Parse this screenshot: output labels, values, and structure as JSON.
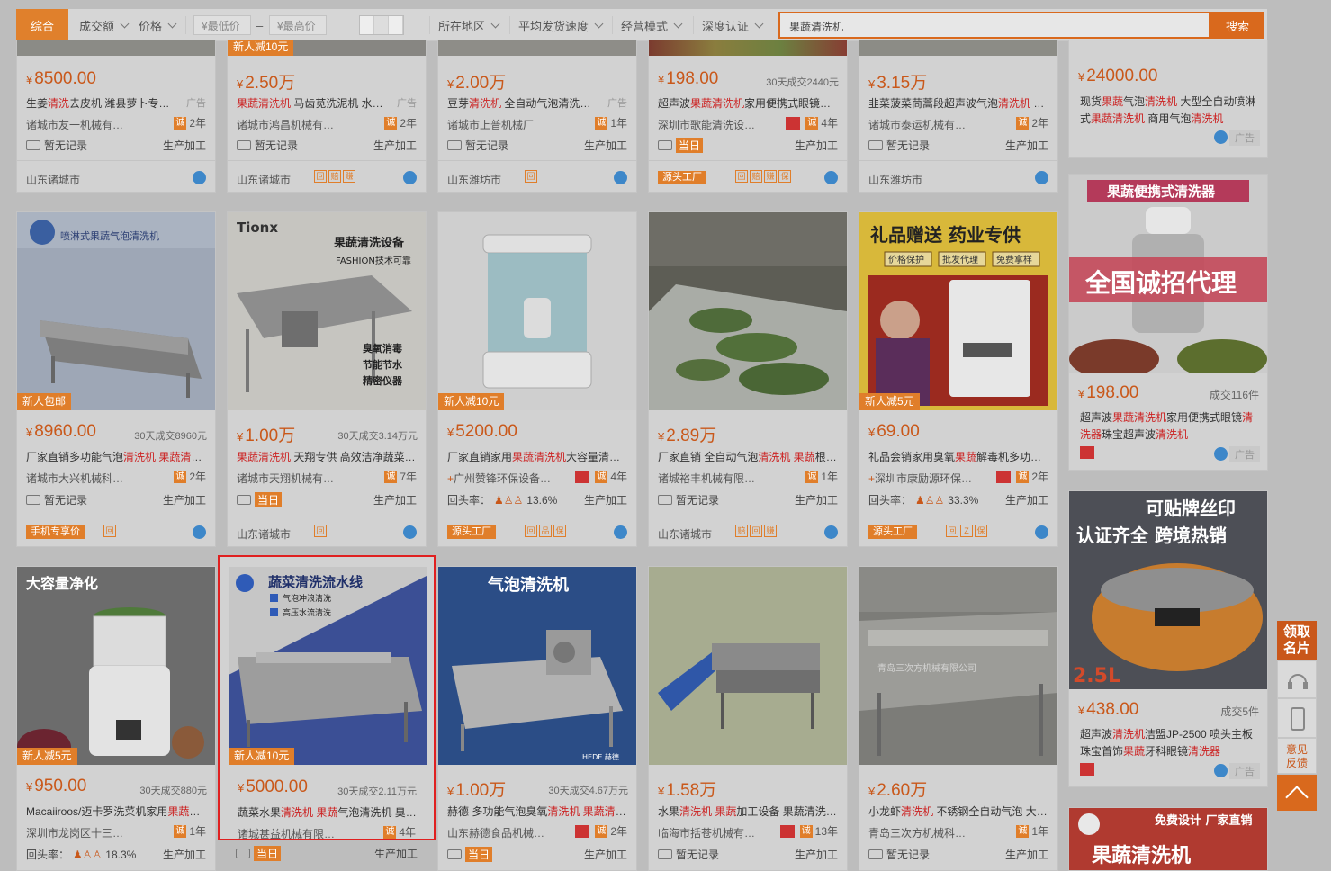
{
  "filter": {
    "tab_all": "综合",
    "sort_volume": "成交额",
    "sort_price": "价格",
    "price_min": "¥最低价",
    "price_dash": "–",
    "price_max": "¥最高价",
    "region": "所在地区",
    "delivery": "平均发货速度",
    "mode": "经营模式",
    "certify": "深度认证",
    "search_value": "果蔬清洗机",
    "search_button": "搜索"
  },
  "row0": [
    {
      "price": "8500.00",
      "sold": "",
      "ad": "广告",
      "title_pre": "生姜",
      "title_em": "清洗",
      "title_post": "去皮机 潍县萝卜专…",
      "shop": "诸城市友一机械有…",
      "years": "2年",
      "record": "暂无记录",
      "proc": "生产加工",
      "loc": "山东诸城市"
    },
    {
      "price": "2.50万",
      "sold": "",
      "ad": "广告",
      "promo": "新人减10元",
      "title_pre": "",
      "title_em": "果蔬清洗机",
      "title_post": " 马齿苋洗泥机 水…",
      "shop": "诸城市鸿昌机械有…",
      "years": "2年",
      "record": "暂无记录",
      "proc": "生产加工",
      "loc": "山东诸城市"
    },
    {
      "price": "2.00万",
      "sold": "",
      "ad": "广告",
      "title_pre": "豆芽",
      "title_em": "清洗机",
      "title_post": " 全自动气泡清洗…",
      "shop": "诸城市上普机械厂",
      "years": "1年",
      "record": "暂无记录",
      "proc": "生产加工",
      "loc": "山东潍坊市"
    },
    {
      "price": "198.00",
      "sold": "30天成交2440元",
      "ad": "",
      "title_pre": "超声波",
      "title_em": "果蔬清洗机",
      "title_post": "家用便携式眼镜…",
      "shop": "深圳市歌能清洗设…",
      "years": "4年",
      "record": "当日",
      "proc": "生产加工",
      "loc": "源头工厂"
    },
    {
      "price": "3.15万",
      "sold": "",
      "ad": "",
      "title_pre": "韭菜菠菜茼蒿段超声波气泡",
      "title_em": "清洗机",
      "title_post": " …",
      "shop": "诸城市泰运机械有…",
      "years": "2年",
      "record": "暂无记录",
      "proc": "生产加工",
      "loc": "山东潍坊市"
    }
  ],
  "row1": [
    {
      "price": "8960.00",
      "sold": "30天成交8960元",
      "promo": "新人包邮",
      "img_text": "喷淋式果蔬气泡清洗机",
      "title_pre": "厂家直销多功能气泡",
      "title_em": "清洗机 果蔬清",
      "title_post": "…",
      "shop": "诸城市大兴机械科…",
      "years": "2年",
      "record": "暂无记录",
      "proc": "生产加工",
      "loc": "手机专享价"
    },
    {
      "price": "1.00万",
      "sold": "30天成交3.14万元",
      "promo": "",
      "img_text": "果蔬清洗设备",
      "img_sub": "FASHION技术可靠",
      "img_brand": "Tionx",
      "title_pre": "",
      "title_em": "果蔬清洗机",
      "title_post": " 天翔专供 高效洁净蔬菜…",
      "shop": "诸城市天翔机械有…",
      "years": "7年",
      "record": "当日",
      "proc": "生产加工",
      "loc": "山东诸城市"
    },
    {
      "price": "5200.00",
      "sold": "",
      "promo": "新人减10元",
      "title_pre": "厂家直销家用",
      "title_em": "果蔬清洗机",
      "title_post": "大容量清…",
      "shop": "广州赞锋环保设备…",
      "years": "4年",
      "record": "回头率：",
      "rate": "13.6%",
      "proc": "生产加工",
      "loc": "源头工厂"
    },
    {
      "price": "2.89万",
      "sold": "",
      "promo": "",
      "title_pre": "厂家直销 全自动气泡",
      "title_em": "清洗机 果蔬",
      "title_post": "根…",
      "shop": "诸城裕丰机械有限…",
      "years": "1年",
      "record": "暂无记录",
      "proc": "生产加工",
      "loc": "山东诸城市"
    },
    {
      "price": "69.00",
      "sold": "",
      "promo": "新人减5元",
      "img_text": "礼品赠送  药业专供",
      "img_tags": [
        "价格保护",
        "批发代理",
        "免费拿样"
      ],
      "title_pre": "礼品会销家用臭氧",
      "title_em": "果蔬",
      "title_post": "解毒机多功…",
      "shop": "深圳市康励源环保…",
      "years": "2年",
      "record": "回头率：",
      "rate": "33.3%",
      "proc": "生产加工",
      "loc": "源头工厂"
    }
  ],
  "row2": [
    {
      "price": "950.00",
      "sold": "30天成交880元",
      "promo": "新人减5元",
      "img_text": "大容量净化",
      "title_pre": "Macaiiroos/迈卡罗洗菜机家用",
      "title_em": "果蔬",
      "title_post": "…",
      "shop": "深圳市龙岗区十三…",
      "years": "1年",
      "record": "回头率：",
      "rate": "18.3%",
      "proc": "生产加工"
    },
    {
      "price": "5000.00",
      "sold": "30天成交2.11万元",
      "promo": "新人减10元",
      "img_text": "蔬菜清洗流水线",
      "img_bullets": [
        "气泡冲浪清洗",
        "高压水流清洗"
      ],
      "title_pre": "蔬菜水果",
      "title_em": "清洗机 果蔬",
      "title_post": "气泡清洗机 臭…",
      "shop": "诸城甚益机械有限…",
      "years": "4年",
      "record": "当日",
      "proc": "生产加工"
    },
    {
      "price": "1.00万",
      "sold": "30天成交4.67万元",
      "promo": "",
      "img_text": "气泡清洗机",
      "img_brand": "HEDE 赫德",
      "title_pre": "赫德 多功能气泡臭氧",
      "title_em": "清洗机 果蔬清",
      "title_post": "…",
      "shop": "山东赫德食品机械…",
      "years": "2年",
      "record": "当日",
      "proc": "生产加工"
    },
    {
      "price": "1.58万",
      "sold": "",
      "promo": "",
      "title_pre": "水果",
      "title_em": "清洗机 果蔬",
      "title_post": "加工设备 果蔬清洗…",
      "shop": "临海市括苍机械有…",
      "years": "13年",
      "record": "暂无记录",
      "proc": "生产加工"
    },
    {
      "price": "2.60万",
      "sold": "",
      "promo": "",
      "img_watermark": "青岛三次方机械有限公司",
      "title_pre": "小龙虾",
      "title_em": "清洗机",
      "title_post": " 不锈钢全自动气泡 大…",
      "shop": "青岛三次方机械科…",
      "years": "1年",
      "record": "暂无记录",
      "proc": "生产加工"
    }
  ],
  "right": [
    {
      "price": "24000.00",
      "sold": "",
      "title": "现货果蔬气泡清洗机 大型全自动喷淋式果蔬清洗机 商用气泡清洗机",
      "ad": "广告"
    },
    {
      "price": "198.00",
      "sold": "成交116件",
      "img_title": "果蔬便携式清洗器",
      "img_banner": "全国诚招代理",
      "title": "超声波果蔬清洗机家用便携式眼镜清洗器珠宝超声波清洗机",
      "ad": "广告"
    },
    {
      "price": "438.00",
      "sold": "成交5件",
      "img_title": "可贴牌丝印",
      "img_sub": "认证齐全 跨境热销",
      "img_size": "2.5L",
      "title": "超声波清洗机洁盟JP-2500 喷头主板珠宝首饰果蔬牙科眼镜清洗器",
      "ad": "广告"
    },
    {
      "img_title": "免费设计 厂家直销",
      "img_banner": "果蔬清洗机"
    }
  ],
  "side": {
    "card_label": "领取名片",
    "feedback": "意见反馈"
  },
  "colors": {
    "accent": "#e07e2a",
    "price": "#c9581a",
    "highlight_border": "#e02020"
  }
}
